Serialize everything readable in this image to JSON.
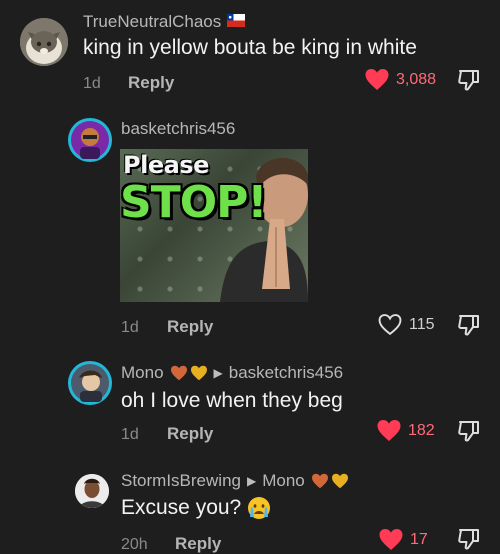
{
  "colors": {
    "background": "#1e1e1e",
    "liked_heart": "#ff3b55",
    "like_count_liked": "#ff6a78"
  },
  "comments": [
    {
      "username": "TrueNeutralChaos",
      "flag": "flag-icon",
      "text": "king in yellow bouta be king in white",
      "time": "1d",
      "reply_label": "Reply",
      "likes": "3,088",
      "liked": true
    },
    {
      "username": "basketchris456",
      "gif": {
        "line1": "Please",
        "line2": "STOP!"
      },
      "time": "1d",
      "reply_label": "Reply",
      "likes": "115",
      "liked": false
    },
    {
      "username": "Mono",
      "reply_to": "basketchris456",
      "text": "oh I love when they beg",
      "time": "1d",
      "reply_label": "Reply",
      "likes": "182",
      "liked": true
    },
    {
      "username": "StormIsBrewing",
      "reply_to": "Mono",
      "text": "Excuse you?",
      "time": "20h",
      "reply_label": "Reply",
      "likes": "17",
      "liked": true
    }
  ]
}
